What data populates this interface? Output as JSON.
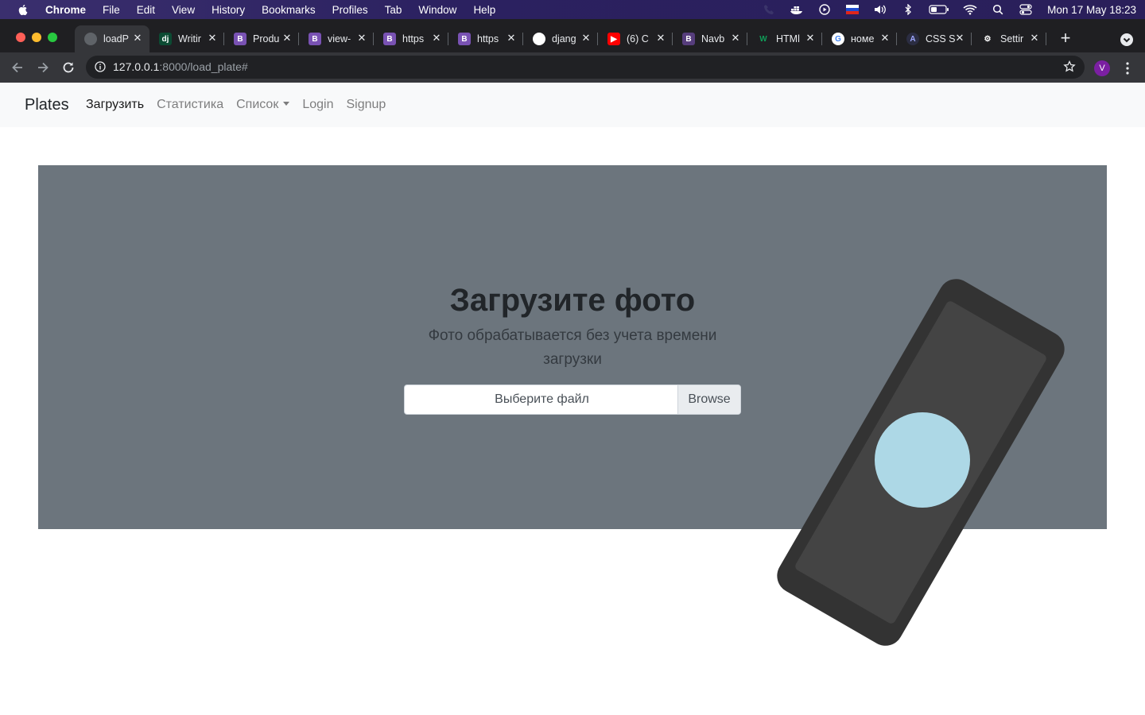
{
  "menubar": {
    "app": "Chrome",
    "items": [
      "File",
      "Edit",
      "View",
      "History",
      "Bookmarks",
      "Profiles",
      "Tab",
      "Window",
      "Help"
    ],
    "clock": "Mon 17 May  18:23"
  },
  "tabs": [
    {
      "title": "loadP",
      "favicon": "globe-icon",
      "fav_text": "",
      "fav_color": "#5f6368",
      "active": true
    },
    {
      "title": "Writir",
      "favicon": "django-icon",
      "fav_text": "dj",
      "fav_color": "#0c4b33"
    },
    {
      "title": "Produ",
      "favicon": "bootstrap-icon",
      "fav_text": "B",
      "fav_color": "#7952b3"
    },
    {
      "title": "view-",
      "favicon": "bootstrap-icon",
      "fav_text": "B",
      "fav_color": "#7952b3"
    },
    {
      "title": "https",
      "favicon": "bootstrap-icon",
      "fav_text": "B",
      "fav_color": "#7952b3"
    },
    {
      "title": "https",
      "favicon": "bootstrap-icon",
      "fav_text": "B",
      "fav_color": "#7952b3"
    },
    {
      "title": "djang",
      "favicon": "github-icon",
      "fav_text": "",
      "fav_color": "#ffffff"
    },
    {
      "title": "(6) C",
      "favicon": "youtube-icon",
      "fav_text": "▶",
      "fav_color": "#ff0000"
    },
    {
      "title": "Navb",
      "favicon": "bootstrap-icon",
      "fav_text": "B",
      "fav_color": "#563d7c"
    },
    {
      "title": "HTMl",
      "favicon": "w-icon",
      "fav_text": "W",
      "fav_color": "#1f1f22"
    },
    {
      "title": "номе",
      "favicon": "google-icon",
      "fav_text": "G",
      "fav_color": "#ffffff"
    },
    {
      "title": "CSS S",
      "favicon": "a-icon",
      "fav_text": "A",
      "fav_color": "#2b2d42"
    },
    {
      "title": "Settir",
      "favicon": "gear-icon",
      "fav_text": "⚙",
      "fav_color": "#1f1f22"
    }
  ],
  "address": {
    "host": "127.0.0.1",
    "path": ":8000/load_plate#"
  },
  "profile_initial": "V",
  "navbar": {
    "brand": "Plates",
    "links": [
      {
        "label": "Загрузить",
        "active": true
      },
      {
        "label": "Статистика",
        "active": false
      },
      {
        "label": "Список",
        "dropdown": true
      },
      {
        "label": "Login",
        "active": false
      },
      {
        "label": "Signup",
        "active": false
      }
    ]
  },
  "hero": {
    "title": "Загрузите фото",
    "lead": "Фото обрабатывается без учета времени загрузки",
    "file_label": "Выберите файл",
    "browse": "Browse"
  },
  "colors": {
    "hero_bg": "#6c757d",
    "phone_body": "#333333",
    "phone_screen": "#444444",
    "phone_circle": "#add8e6"
  }
}
